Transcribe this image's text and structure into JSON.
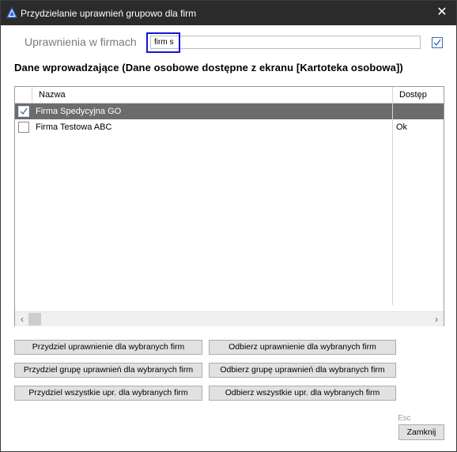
{
  "window": {
    "title": "Przydzielanie uprawnień grupowo dla firm",
    "close_glyph": "✕"
  },
  "filter": {
    "label": "Uprawnienia w firmach",
    "value": "firm s",
    "checked": true
  },
  "section_title": "Dane wprowadzające (Dane osobowe dostępne z ekranu [Kartoteka osobowa])",
  "grid": {
    "columns": [
      "Nazwa",
      "Dostęp"
    ],
    "rows": [
      {
        "checked": true,
        "name": "Firma Spedycyjna GO",
        "access": "",
        "selected": true
      },
      {
        "checked": false,
        "name": "Firma Testowa ABC",
        "access": "Ok",
        "selected": false
      }
    ],
    "scroll_left": "‹",
    "scroll_right": "›"
  },
  "buttons": {
    "assign_perm": "Przydziel uprawnienie dla wybranych firm",
    "revoke_perm": "Odbierz uprawnienie dla wybranych firm",
    "assign_group": "Przydziel grupę uprawnień dla wybranych firm",
    "revoke_group": "Odbierz grupę uprawnień dla wybranych firm",
    "assign_all": "Przydziel wszystkie upr. dla wybranych firm",
    "revoke_all": "Odbierz wszystkie upr. dla wybranych firm"
  },
  "footer": {
    "esc_hint": "Esc",
    "close_label": "Zamknij"
  },
  "colors": {
    "titlebar": "#2b2b2b",
    "selected_row": "#6c6c6c",
    "focus_border": "#1515d6",
    "check_accent": "#2f6fb0"
  }
}
